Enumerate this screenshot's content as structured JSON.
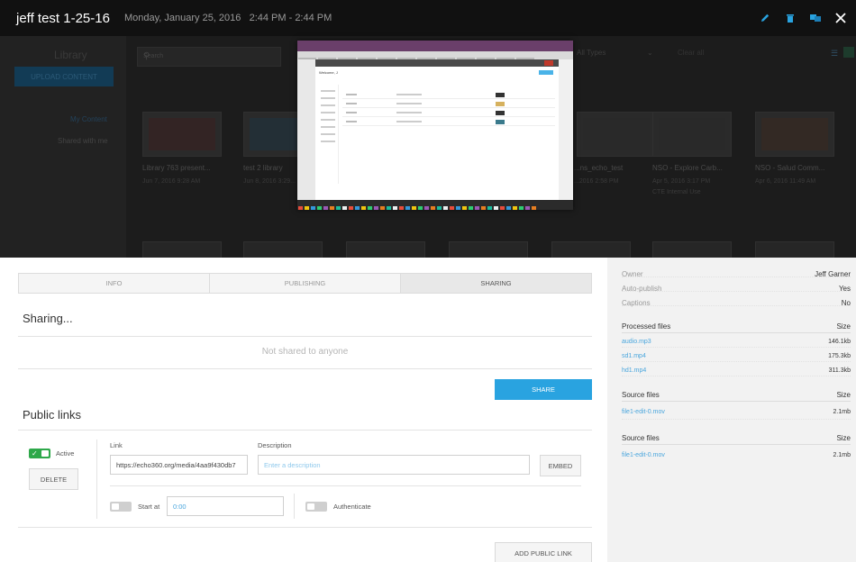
{
  "header": {
    "title": "jeff test 1-25-16",
    "date": "Monday, January 25, 2016",
    "time": "2:44 PM - 2:44 PM"
  },
  "library": {
    "title": "Library",
    "upload_label": "UPLOAD CONTENT",
    "nav": [
      "My Content",
      "Shared with me"
    ],
    "search_placeholder": "Search",
    "type_filter": "All Types",
    "clear_label": "Clear all",
    "tiles": [
      {
        "title": "Library 763 present...",
        "date": "Jun 7, 2016 9:28 AM",
        "sub": ""
      },
      {
        "title": "test 2 library",
        "date": "Jun 8, 2016 3:29...",
        "sub": ""
      },
      {
        "title": "",
        "date": "",
        "sub": ""
      },
      {
        "title": "",
        "date": "",
        "sub": ""
      },
      {
        "title": "...ns_echo_test",
        "date": "...2016 2:58 PM",
        "sub": ""
      },
      {
        "title": "NSO - Explore Carb...",
        "date": "Apr 5, 2016 3:17 PM",
        "sub": "CTE Internal Use"
      },
      {
        "title": "NSO - Salud Comm...",
        "date": "Apr 6, 2016 11:49 AM",
        "sub": ""
      }
    ]
  },
  "preview": {
    "welcome": "Welcome, J"
  },
  "tabs": [
    {
      "label": "INFO",
      "active": false
    },
    {
      "label": "PUBLISHING",
      "active": false
    },
    {
      "label": "SHARING",
      "active": true
    }
  ],
  "sharing": {
    "heading": "Sharing...",
    "empty_text": "Not shared to anyone",
    "share_button": "SHARE"
  },
  "public_links": {
    "heading": "Public links",
    "active_label": "Active",
    "delete_label": "DELETE",
    "link_label": "Link",
    "link_value": "https://echo360.org/media/4aa9f430db7",
    "description_label": "Description",
    "description_placeholder": "Enter a description",
    "embed_label": "EMBED",
    "start_at_label": "Start at",
    "start_at_value": "0:00",
    "authenticate_label": "Authenticate",
    "add_button": "ADD PUBLIC LINK"
  },
  "info": {
    "meta": [
      {
        "key": "Owner",
        "value": "Jeff Garner"
      },
      {
        "key": "Auto-publish",
        "value": "Yes"
      },
      {
        "key": "Captions",
        "value": "No"
      }
    ],
    "processed": {
      "heading": "Processed files",
      "size_label": "Size",
      "files": [
        {
          "name": "audio.mp3",
          "size": "146.1kb"
        },
        {
          "name": "sd1.mp4",
          "size": "175.3kb"
        },
        {
          "name": "hd1.mp4",
          "size": "311.3kb"
        }
      ]
    },
    "source1": {
      "heading": "Source files",
      "size_label": "Size",
      "files": [
        {
          "name": "file1-edit-0.mov",
          "size": "2.1mb"
        }
      ]
    },
    "source2": {
      "heading": "Source files",
      "size_label": "Size",
      "files": [
        {
          "name": "file1-edit-0.mov",
          "size": "2.1mb"
        }
      ]
    }
  },
  "colors": {
    "accent": "#29a3e0",
    "toggle_on": "#2ea84a",
    "header_bg": "#111111"
  },
  "icons": [
    "pencil-icon",
    "trash-icon",
    "move-icon",
    "close-icon",
    "search-icon",
    "chevron-down-icon",
    "list-view-icon",
    "grid-view-icon"
  ]
}
